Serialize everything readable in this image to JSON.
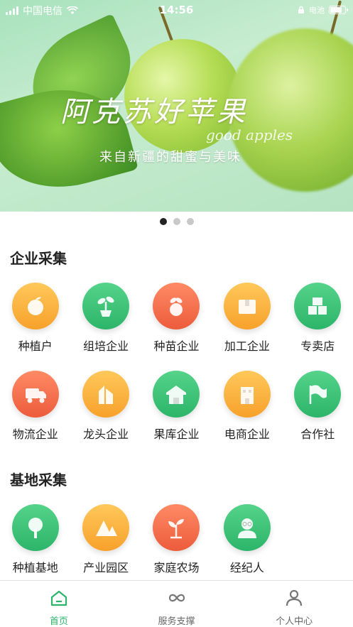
{
  "status_bar": {
    "carrier": "中国电信",
    "time": "14:56",
    "battery_text": "电池",
    "battery_level": 0.85
  },
  "banner": {
    "title": "阿克苏好苹果",
    "subtitle_en": "good apples",
    "subtitle_cn": "来自新疆的甜蜜与美味",
    "pages": 3,
    "active_page": 0
  },
  "enterprise": {
    "title": "企业采集",
    "items": [
      {
        "label": "种植户",
        "icon": "orange-fruit-icon",
        "color": "orange"
      },
      {
        "label": "组培企业",
        "icon": "seedling-pot-icon",
        "color": "green"
      },
      {
        "label": "种苗企业",
        "icon": "sapling-fruit-icon",
        "color": "red"
      },
      {
        "label": "加工企业",
        "icon": "package-box-icon",
        "color": "orange"
      },
      {
        "label": "专卖店",
        "icon": "store-boxes-icon",
        "color": "green"
      },
      {
        "label": "物流企业",
        "icon": "truck-icon",
        "color": "red"
      },
      {
        "label": "龙头企业",
        "icon": "building-icon",
        "color": "orange"
      },
      {
        "label": "果库企业",
        "icon": "warehouse-icon",
        "color": "green"
      },
      {
        "label": "电商企业",
        "icon": "office-building-icon",
        "color": "orange"
      },
      {
        "label": "合作社",
        "icon": "flag-icon",
        "color": "green"
      }
    ]
  },
  "base": {
    "title": "基地采集",
    "items": [
      {
        "label": "种植基地",
        "icon": "tree-icon",
        "color": "green"
      },
      {
        "label": "产业园区",
        "icon": "tent-park-icon",
        "color": "orange"
      },
      {
        "label": "家庭农场",
        "icon": "plant-sprout-icon",
        "color": "red"
      },
      {
        "label": "经纪人",
        "icon": "person-glasses-icon",
        "color": "green"
      }
    ]
  },
  "tabbar": {
    "items": [
      {
        "label": "首页",
        "icon": "home-icon",
        "active": true
      },
      {
        "label": "服务支撑",
        "icon": "infinity-icon",
        "active": false
      },
      {
        "label": "个人中心",
        "icon": "user-icon",
        "active": false
      }
    ]
  },
  "colors": {
    "accent_green": "#2cb56a",
    "orange": "#f7a12b",
    "red": "#ec5c3b"
  }
}
